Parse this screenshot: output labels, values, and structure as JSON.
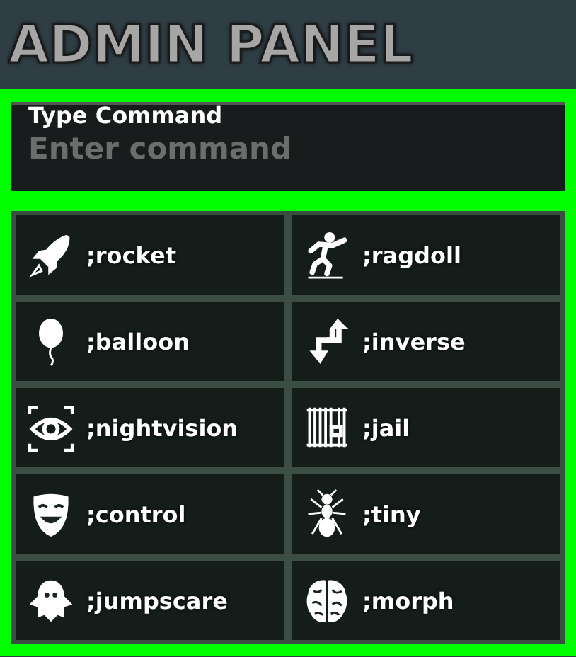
{
  "title": "ADMIN PANEL",
  "command_box": {
    "label": "Type Command",
    "placeholder": "Enter command"
  },
  "commands": [
    {
      "label": ";rocket"
    },
    {
      "label": ";ragdoll"
    },
    {
      "label": ";balloon"
    },
    {
      "label": ";inverse"
    },
    {
      "label": ";nightvision"
    },
    {
      "label": ";jail"
    },
    {
      "label": ";control"
    },
    {
      "label": ";tiny"
    },
    {
      "label": ";jumpscare"
    },
    {
      "label": ";morph"
    }
  ]
}
